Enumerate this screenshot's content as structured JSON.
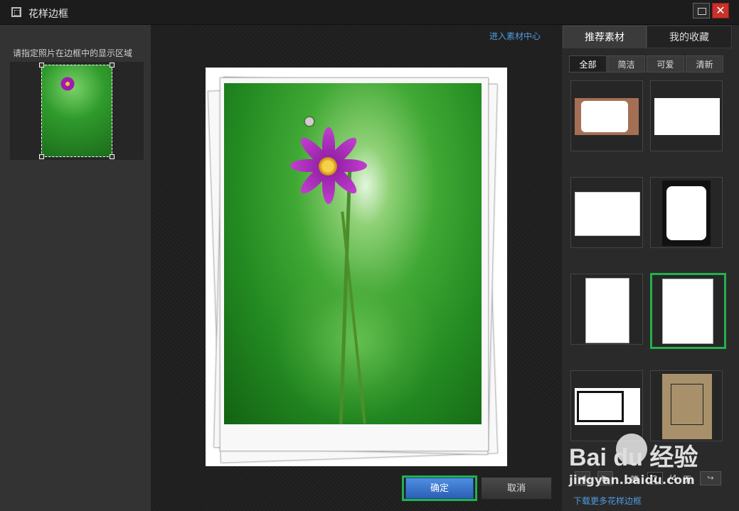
{
  "window": {
    "title": "花样边框",
    "close_symbol": "✕"
  },
  "left": {
    "label": "请指定照片在边框中的显示区域"
  },
  "center": {
    "enter_link": "进入素材中心",
    "ok_label": "确定",
    "cancel_label": "取消"
  },
  "right": {
    "tabs": [
      "推荐素材",
      "我的收藏"
    ],
    "subtabs": [
      "全部",
      "简洁",
      "可爱",
      "清新"
    ],
    "tiles": [
      "frame-1",
      "frame-2",
      "frame-3",
      "frame-4",
      "frame-5",
      "frame-6",
      "frame-7",
      "frame-8"
    ],
    "selected_tile": 6,
    "pager": {
      "prefix": "第",
      "current": "2",
      "total": "/4",
      "suffix": "页"
    },
    "download_link": "下载更多花样边框"
  },
  "watermark": {
    "brand": "Bai du 经验",
    "url": "jingyan.baidu.com"
  },
  "colors": {
    "accent": "#22b14c",
    "link": "#4f9be0",
    "ok_button": "#3a73cc"
  }
}
